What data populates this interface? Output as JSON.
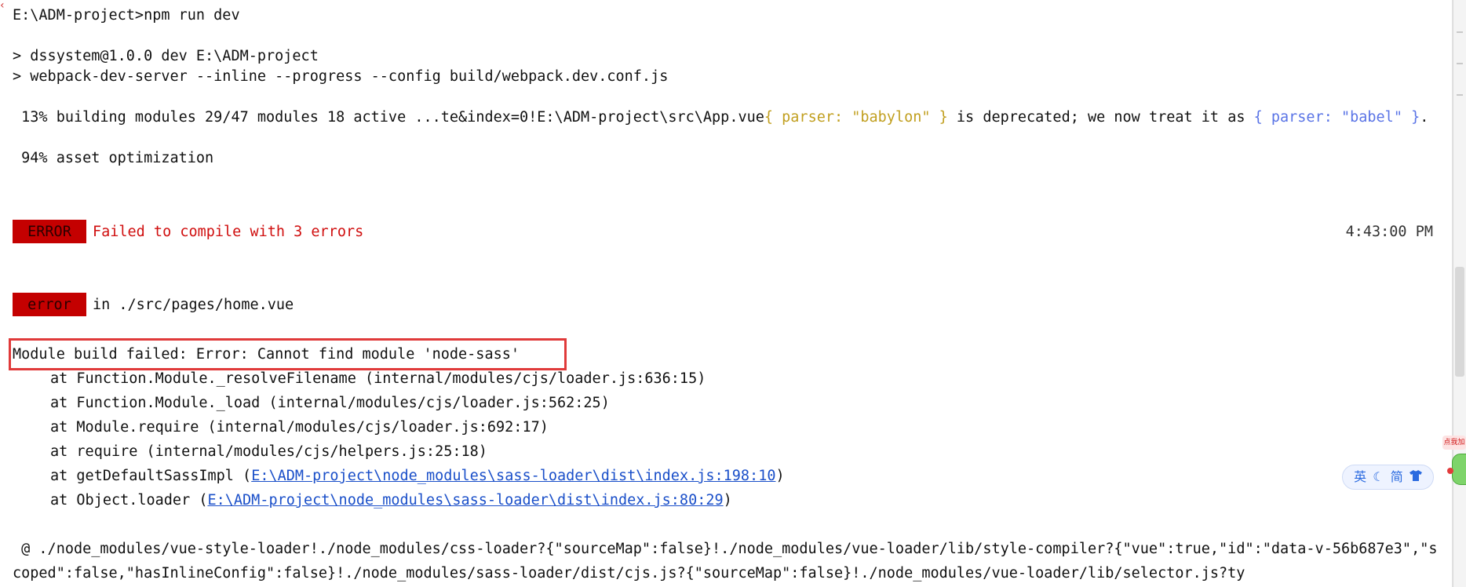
{
  "terminal": {
    "cmd": "E:\\ADM-project>npm run dev",
    "script1": "> dssystem@1.0.0 dev E:\\ADM-project",
    "script2": "> webpack-dev-server --inline --progress --config build/webpack.dev.conf.js",
    "build_prefix": " 13% building modules 29/47 modules 18 active ...te&index=0!E:\\ADM-project\\src\\App.vue",
    "build_y1": "{ parser: \"babylon\" }",
    "build_mid": " is deprecated; we now treat it as ",
    "build_b1": "{ parser: \"babel\" }",
    "build_end": ".",
    "progress2": " 94% asset optimization",
    "error_badge": " ERROR ",
    "error_msg": "Failed to compile with 3 errors",
    "timestamp": "4:43:00 PM",
    "error_badge2": " error ",
    "error_in": "in ./src/pages/home.vue",
    "module_fail": "Module build failed: Error: Cannot find module 'node-sass'",
    "stack": [
      {
        "text": "at Function.Module._resolveFilename (internal/modules/cjs/loader.js:636:15)"
      },
      {
        "text": "at Function.Module._load (internal/modules/cjs/loader.js:562:25)"
      },
      {
        "text": "at Module.require (internal/modules/cjs/loader.js:692:17)"
      },
      {
        "text": "at require (internal/modules/cjs/helpers.js:25:18)"
      }
    ],
    "stack_link1_pre": "at getDefaultSassImpl (",
    "stack_link1": "E:\\ADM-project\\node_modules\\sass-loader\\dist\\index.js:198:10",
    "stack_link1_post": ")",
    "stack_link2_pre": "at Object.loader (",
    "stack_link2": "E:\\ADM-project\\node_modules\\sass-loader\\dist\\index.js:80:29",
    "stack_link2_post": ")",
    "at_line": " @ ./node_modules/vue-style-loader!./node_modules/css-loader?{\"sourceMap\":false}!./node_modules/vue-loader/lib/style-compiler?{\"vue\":true,\"id\":\"data-v-56b687e3\",\"scoped\":false,\"hasInlineConfig\":false}!./node_modules/sass-loader/dist/cjs.js?{\"sourceMap\":false}!./node_modules/vue-loader/lib/selector.js?ty"
  },
  "ime": {
    "lang": "英",
    "mode_icon": "moon-icon",
    "script": "简",
    "skin_icon": "shirt-icon"
  },
  "promo": {
    "label": "点我加"
  },
  "colors": {
    "error_red": "#c40000",
    "highlight_border": "#e03a3a",
    "link_blue": "#1a4fc9",
    "warn_yellow": "#c19f1f",
    "babel_blue": "#5a74e6"
  }
}
